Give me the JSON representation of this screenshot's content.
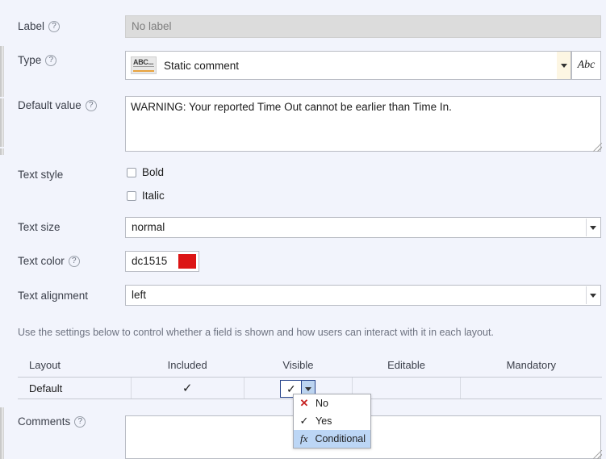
{
  "theme": {
    "background": "#f2f4fc",
    "accent_blue": "#28458c",
    "highlight": "#bcd6f5",
    "swatch_color": "#dc1515",
    "error_red": "#c62222"
  },
  "fields": {
    "label": {
      "label": "Label",
      "help_icon": "?",
      "value": "No label",
      "disabled": true
    },
    "type": {
      "label": "Type",
      "help_icon": "?",
      "icon_name": "abc-static-text-icon",
      "icon_text": "ABC...",
      "value": "Static comment",
      "dropdown_icon": "chevron-down-icon",
      "side_button_label": "Abc"
    },
    "default_value": {
      "label": "Default value",
      "help_icon": "?",
      "value": "WARNING: Your reported Time Out cannot be earlier than Time In.",
      "placeholder": ""
    },
    "text_style": {
      "label": "Text style",
      "options": [
        {
          "label": "Bold",
          "checked": false
        },
        {
          "label": "Italic",
          "checked": false
        }
      ]
    },
    "text_size": {
      "label": "Text size",
      "value": "normal"
    },
    "text_color": {
      "label": "Text color",
      "help_icon": "?",
      "value": "dc1515",
      "swatch": "#dc1515"
    },
    "text_alignment": {
      "label": "Text alignment",
      "value": "left"
    },
    "comments": {
      "label": "Comments",
      "help_icon": "?",
      "value": "",
      "placeholder": ""
    }
  },
  "layout_section": {
    "help_text": "Use the settings below to control whether a field is shown and how users can interact with it in each layout.",
    "columns": [
      "Layout",
      "Included",
      "Visible",
      "Editable",
      "Mandatory"
    ],
    "rows": [
      {
        "layout": "Default",
        "included": "✓",
        "visible": "✓",
        "editable": "",
        "mandatory": ""
      }
    ]
  },
  "open_dropdown": {
    "anchor": "visible-cell",
    "items": [
      {
        "icon": "cross-icon",
        "glyph": "✕",
        "label": "No",
        "selected": false
      },
      {
        "icon": "check-icon",
        "glyph": "✓",
        "label": "Yes",
        "selected": false
      },
      {
        "icon": "fx-function-icon",
        "glyph": "fx",
        "label": "Conditional",
        "selected": true
      }
    ]
  }
}
